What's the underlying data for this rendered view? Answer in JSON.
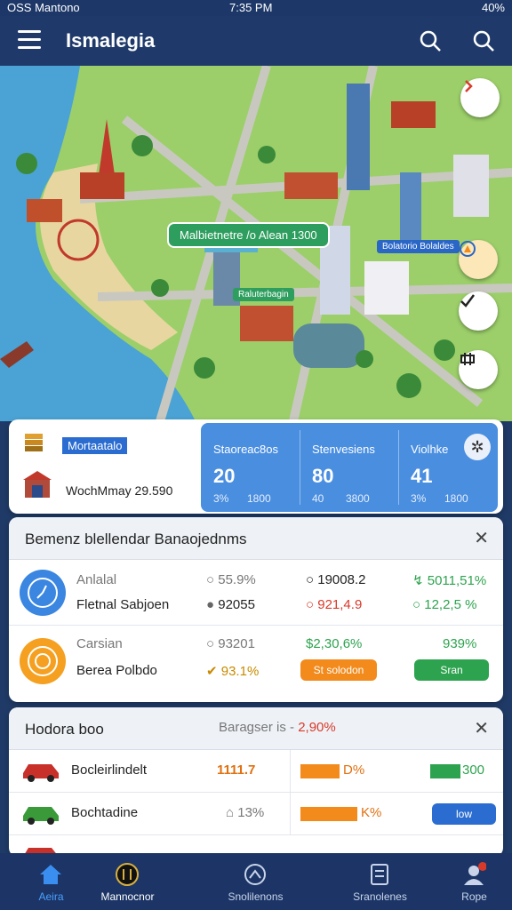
{
  "status_bar": {
    "carrier": "OSS Mantono",
    "time": "7:35 PM",
    "battery": "40%"
  },
  "app_bar": {
    "title": "Ismalegia"
  },
  "map": {
    "callout": "Malbietnetre /o Alean 1300",
    "tag_right": "Bolatorio Bolaldes",
    "tag_center": "Raluterbagin"
  },
  "summary": {
    "badge_label": "Mortaatalo",
    "subtitle": "WochMmay 29.590",
    "stats": [
      {
        "label": "Staoreac8os",
        "value": "20",
        "sub1": "3%",
        "sub2": "1800"
      },
      {
        "label": "Stenvesiens",
        "value": "80",
        "sub1": "40",
        "sub2": "3800"
      },
      {
        "label": "Violhke",
        "value": "41",
        "sub1": "3%",
        "sub2": "1800"
      }
    ]
  },
  "benefits_panel": {
    "title": "Bemenz blellendar Banaojednms",
    "rows": [
      {
        "label_top": "Anlalal",
        "label_bottom": "Fletnal Sabjoen",
        "c1_top": "55.9%",
        "c1_bottom": "92055",
        "c2_top": "19008.2",
        "c2_bottom": "921,4.9",
        "c3_top": "5011,51%",
        "c3_bottom": "12,2,5 %"
      },
      {
        "label_top": "Carsian",
        "label_bottom": "Berea Polbdo",
        "c1_top": "93201",
        "c1_bottom": "93.1%",
        "c2_top": "$2,30,6%",
        "c2_bottom": "St solodon",
        "c3_top": "939%",
        "c3_bottom": "Sran"
      }
    ]
  },
  "vehicles_panel": {
    "title": "Hodora boo",
    "subtitle": "Baragser is -",
    "subtitle_value": "2,90%",
    "rows": [
      {
        "name": "Bocleirlindelt",
        "value": "1111.7",
        "pct": "D%",
        "right": "300"
      },
      {
        "name": "Bochtadine",
        "value": "13%",
        "pct": "K%",
        "right": "low"
      }
    ]
  },
  "bottom_nav": [
    {
      "label": "Aeira"
    },
    {
      "label": "Mannocnor"
    },
    {
      "label": "Snolilenons"
    },
    {
      "label": "Sranolenes"
    },
    {
      "label": "Rope"
    }
  ],
  "colors": {
    "primary": "#1f3a6a",
    "accent_blue": "#4a8ee0",
    "green": "#2ea34f",
    "orange": "#f28a1c",
    "red": "#d83a2a"
  }
}
